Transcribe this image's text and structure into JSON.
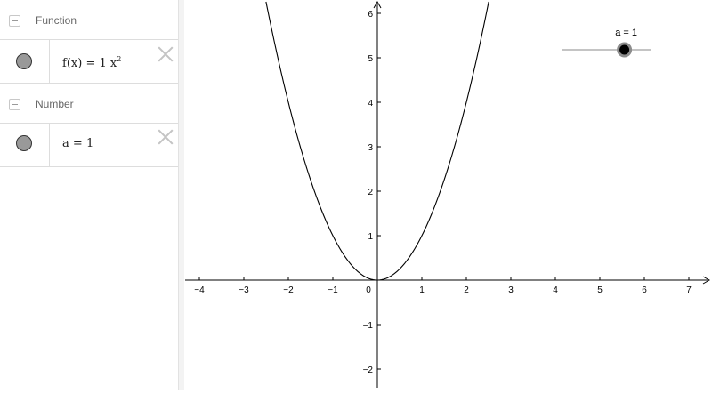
{
  "algebra": {
    "groups": [
      {
        "label": "Function",
        "item": {
          "f_name": "f",
          "x": "x",
          "lhs_open": "(",
          "lhs_close": ")",
          "eq": "=",
          "coef": "1",
          "var": "x",
          "exp": "2",
          "marble_color": "#999999"
        }
      },
      {
        "label": "Number",
        "item": {
          "name": "a",
          "eq": "=",
          "value": "1",
          "marble_color": "#999999"
        }
      }
    ]
  },
  "graphics": {
    "x_ticks": [
      "−4",
      "−3",
      "−2",
      "−1",
      "0",
      "1",
      "2",
      "3",
      "4",
      "5",
      "6",
      "7"
    ],
    "y_ticks": [
      "−2",
      "−1",
      "1",
      "2",
      "3",
      "4",
      "5",
      "6"
    ],
    "slider": {
      "label": "a = 1",
      "value": 1,
      "min": -5,
      "max": 5
    },
    "curve_color": "#000000",
    "slider_knob_color": "#000000"
  },
  "chart_data": {
    "type": "line",
    "series": [
      {
        "name": "f(x) = 1x²",
        "equation": "y = a·x²",
        "a": 1,
        "x": [
          -2.6,
          -2,
          -1.5,
          -1,
          -0.5,
          0,
          0.5,
          1,
          1.5,
          2,
          2.5
        ],
        "y": [
          6.76,
          4,
          2.25,
          1,
          0.25,
          0,
          0.25,
          1,
          2.25,
          4,
          6.25
        ]
      }
    ],
    "xlim": [
      -4.3,
      7.5
    ],
    "ylim": [
      -2.4,
      6.3
    ],
    "grid": false
  }
}
